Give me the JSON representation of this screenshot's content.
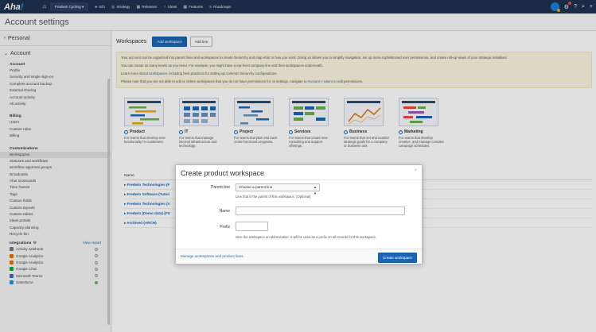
{
  "topnav": {
    "logo": "Aha",
    "logo_ex": "!",
    "workspace": "Fredwin Cycling",
    "items": [
      {
        "label": "Info",
        "icon": "info-icon",
        "glyph": "●"
      },
      {
        "label": "Strategy",
        "icon": "strategy-icon",
        "glyph": "◎"
      },
      {
        "label": "Releases",
        "icon": "releases-icon",
        "glyph": "▦"
      },
      {
        "label": "Ideas",
        "icon": "lightbulb-icon",
        "glyph": "♀"
      },
      {
        "label": "Features",
        "icon": "features-icon",
        "glyph": "▦"
      },
      {
        "label": "Roadmaps",
        "icon": "roadmaps-icon",
        "glyph": "≡"
      }
    ]
  },
  "page": {
    "title": "Account settings"
  },
  "sidebar": {
    "personal": "Personal",
    "account_header": "Account",
    "sections": [
      {
        "title": "Account",
        "items": [
          "Profile",
          "Security and single sign-on",
          "Complete account backup",
          "External sharing",
          "Account activity",
          "All activity"
        ]
      },
      {
        "title": "Billing",
        "items": [
          "Users",
          "Custom roles",
          "Billing"
        ]
      },
      {
        "title": "Customizations",
        "items": [
          "Workspaces",
          "Statuses and workflows",
          "Workflow approval groups",
          "Broadcasts",
          "Aha! scorecards",
          "Time frames",
          "Tags",
          "Custom fields",
          "Custom layouts",
          "Custom tables",
          "Ideas portals",
          "Capacity planning",
          "Recycle bin"
        ]
      }
    ],
    "active_item": "Workspaces",
    "integrations": {
      "title": "Integrations",
      "view_report": "View report",
      "apps": [
        {
          "name": "Activity webhook",
          "color": "#6c7a89",
          "enabled": false
        },
        {
          "name": "Google Analytics",
          "color": "#e37400",
          "enabled": false
        },
        {
          "name": "Google Analytics",
          "color": "#e37400",
          "enabled": false
        },
        {
          "name": "Google Chat",
          "color": "#00ac47",
          "enabled": false
        },
        {
          "name": "Microsoft Teams",
          "color": "#5059c9",
          "enabled": false
        },
        {
          "name": "Salesforce",
          "color": "#00a1e0",
          "enabled": true
        }
      ]
    }
  },
  "main": {
    "title": "Workspaces",
    "add_workspace": "Add workspace",
    "add_line": "Add line",
    "info": [
      "Your account can be organized into parent lines and workspaces to create hierarchy and map Aha! to how you work. Doing so allows you to simplify navigation, set up more sophisticated user permissions, and create roll-up views of your strategic initiatives.",
      "You can create as many levels as you need. For example, you might have a top-level company line and then workspaces underneath."
    ],
    "info_learn_pre": "Learn more about ",
    "info_learn_link": "workspaces",
    "info_learn_post": ", including best practices for setting up common hierarchy configurations.",
    "info_note_pre": "Please note that you are not able to edit or delete workspaces that you do not have permissions for. In settings, navigate to ",
    "info_note_link": "Account > Users",
    "info_note_post": " to edit permissions.",
    "templates": [
      {
        "name": "Product",
        "desc": "For teams that develop new functionality for customers."
      },
      {
        "name": "IT",
        "desc": "For teams that manage internal infrastructure and technology."
      },
      {
        "name": "Project",
        "desc": "For teams that plan and track cross-functional programs."
      },
      {
        "name": "Services",
        "desc": "For teams that create new consulting and support offerings."
      },
      {
        "name": "Business",
        "desc": "For teams that set and monitor strategic goals for a company or business unit."
      },
      {
        "name": "Marketing",
        "desc": "For teams that develop creative, and manage complex campaign schedules."
      }
    ],
    "table_header": "Name",
    "rows": [
      "Fredwin Technologies (F",
      "Fredwin Software (Tutori",
      "Fredwin Technologies (V",
      "Fredwin (Demo data) (FS",
      "Archived (ARCH)"
    ]
  },
  "modal": {
    "title": "Create product workspace",
    "close": "×",
    "parent_label": "Parent line",
    "parent_value": "Choose a parent line",
    "parent_help": "Line that is the parent of this workspace. (Optional)",
    "name_label": "Name",
    "name_value": "",
    "prefix_label": "Prefix",
    "prefix_value": "",
    "prefix_help": "Give the workspace an abbreviation. It will be used as a prefix on all records for this workspace.",
    "footer_link": "Manage workspaces and product lines.",
    "submit": "Create workspace"
  },
  "colors": {
    "nav_bg": "#1e3250",
    "primary": "#1a66b5",
    "info_bg": "#fbf6e1"
  }
}
